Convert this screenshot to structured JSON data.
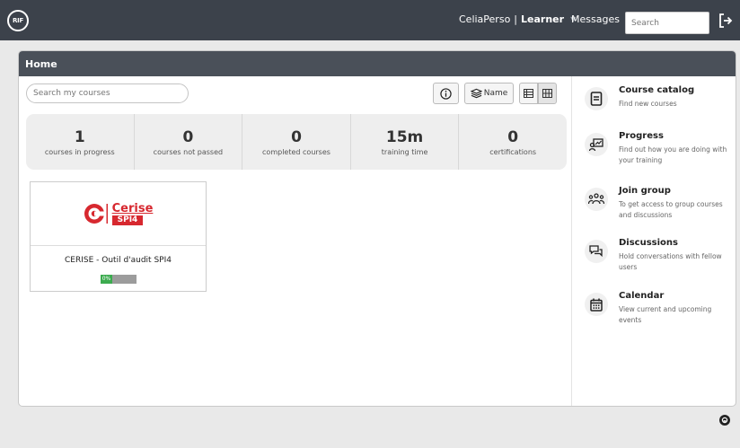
{
  "header": {
    "logo_text": "RIF",
    "user_name": "CeliaPerso",
    "user_role": "Learner",
    "messages_label": "Messages",
    "search_placeholder": "Search"
  },
  "panel": {
    "title": "Home",
    "search_placeholder": "Search my courses",
    "sort_label": "Name"
  },
  "stats": [
    {
      "value": "1",
      "label": "courses in progress"
    },
    {
      "value": "0",
      "label": "courses not passed"
    },
    {
      "value": "0",
      "label": "completed courses"
    },
    {
      "value": "15m",
      "label": "training time"
    },
    {
      "value": "0",
      "label": "certifications"
    }
  ],
  "courses": [
    {
      "logo_word": "Cerise",
      "logo_sub": "SPI4",
      "title": "CERISE - Outil d'audit SPI4",
      "progress": 0,
      "progress_label": "0%"
    }
  ],
  "sidebar": [
    {
      "title": "Course catalog",
      "desc": "Find new courses",
      "icon": "catalog-icon"
    },
    {
      "title": "Progress",
      "desc": "Find out how you are doing with your training",
      "icon": "progress-icon"
    },
    {
      "title": "Join group",
      "desc": "To get access to group courses and discussions",
      "icon": "group-icon"
    },
    {
      "title": "Discussions",
      "desc": "Hold conversations with fellow users",
      "icon": "discussions-icon"
    },
    {
      "title": "Calendar",
      "desc": "View current and upcoming events",
      "icon": "calendar-icon"
    }
  ],
  "colors": {
    "topbar": "#3c424b",
    "panel_header": "#4a5059",
    "brand_red": "#d7282f",
    "progress_green": "#3cab4f"
  }
}
